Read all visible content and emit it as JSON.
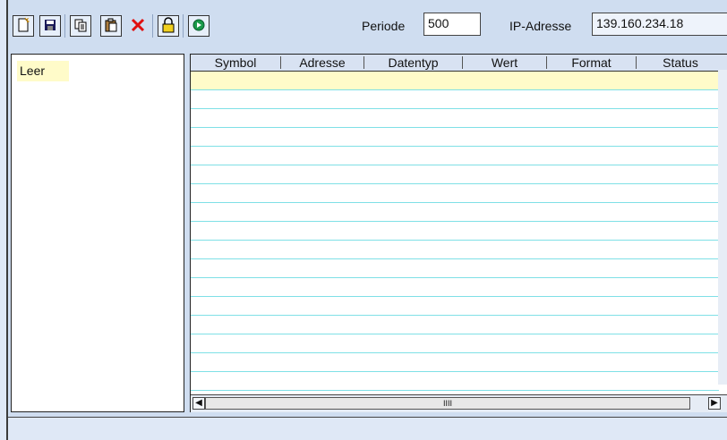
{
  "toolbar": {
    "buttons": [
      {
        "name": "new-icon"
      },
      {
        "name": "save-icon"
      },
      {
        "name": "copy-icon"
      },
      {
        "name": "paste-icon"
      },
      {
        "name": "delete-icon"
      },
      {
        "name": "lock-icon"
      },
      {
        "name": "run-icon"
      }
    ],
    "periode_label": "Periode",
    "periode_value": "500",
    "ip_label": "IP-Adresse",
    "ip_value": "139.160.234.18"
  },
  "left_panel": {
    "item": "Leer"
  },
  "grid": {
    "columns": [
      "Symbol",
      "Adresse",
      "Datentyp",
      "Wert",
      "Format",
      "Status"
    ],
    "rows": []
  },
  "scroll": {
    "thumb_grip": "IIII"
  },
  "colors": {
    "toolbar_bg": "#cfddf0",
    "selection": "#fffbc9",
    "row_line": "#7fe0e6",
    "delete_red": "#e01010",
    "run_green": "#1a9a4a"
  }
}
